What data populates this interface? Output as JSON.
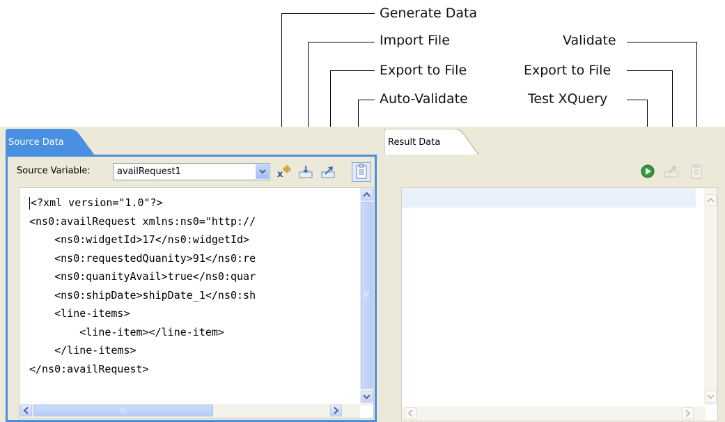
{
  "callouts": {
    "generate_data": "Generate Data",
    "import_file": "Import File",
    "export_to_file_left": "Export to File",
    "auto_validate": "Auto-Validate",
    "validate": "Validate",
    "export_to_file_right": "Export to File",
    "test_xquery": "Test XQuery"
  },
  "source_panel": {
    "tab_label": "Source Data",
    "variable_label": "Source Variable:",
    "variable_value": "availRequest1",
    "code_lines": [
      "<?xml version=\"1.0\"?>",
      "<ns0:availRequest xmlns:ns0=\"http://",
      "    <ns0:widgetId>17</ns0:widgetId>",
      "    <ns0:requestedQuanity>91</ns0:re",
      "    <ns0:quanityAvail>true</ns0:quar",
      "    <ns0:shipDate>shipDate_1</ns0:sh",
      "    <line-items>",
      "        <line-item></line-item>",
      "    </line-items>",
      "</ns0:availRequest>"
    ],
    "toolbar": [
      "generate-data-icon",
      "import-file-icon",
      "export-file-icon",
      "auto-validate-icon"
    ]
  },
  "result_panel": {
    "tab_label": "Result Data",
    "toolbar": [
      "test-xquery-icon",
      "export-file-icon",
      "validate-icon"
    ]
  },
  "colors": {
    "active_tab": "#4a90e2",
    "panel_bg": "#ece9d8",
    "run_green": "#2f9a3c"
  }
}
